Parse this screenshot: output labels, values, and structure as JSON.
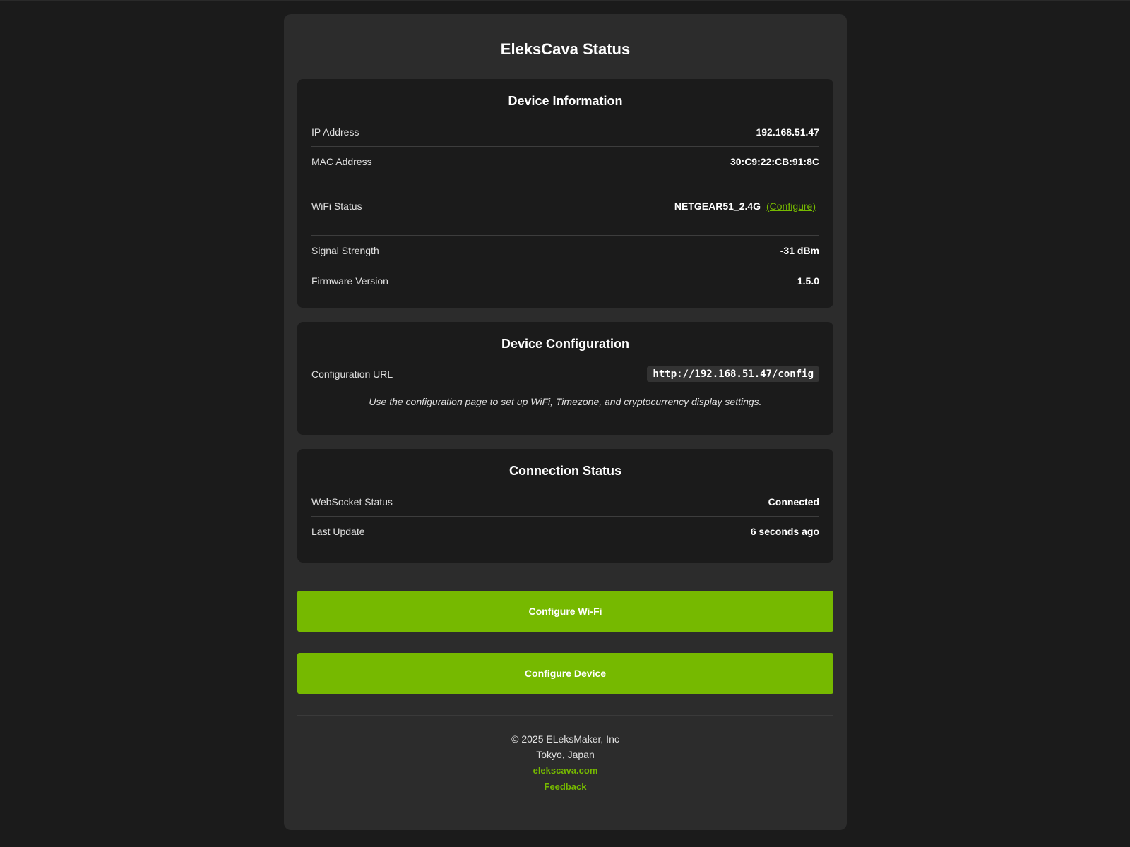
{
  "page": {
    "title": "EleksCava Status"
  },
  "device_info": {
    "title": "Device Information",
    "rows": [
      {
        "label": "IP Address",
        "value": "192.168.51.47"
      },
      {
        "label": "MAC Address",
        "value": "30:C9:22:CB:91:8C"
      },
      {
        "label": "WiFi Status",
        "value": "NETGEAR51_2.4G",
        "link": "(Configure)"
      },
      {
        "label": "Signal Strength",
        "value": "-31 dBm"
      },
      {
        "label": "Firmware Version",
        "value": "1.5.0"
      }
    ]
  },
  "device_config": {
    "title": "Device Configuration",
    "url_label": "Configuration URL",
    "url_value": "http://192.168.51.47/config",
    "note": "Use the configuration page to set up WiFi, Timezone, and cryptocurrency display settings."
  },
  "connection": {
    "title": "Connection Status",
    "rows": [
      {
        "label": "WebSocket Status",
        "value": "Connected"
      },
      {
        "label": "Last Update",
        "value": "6 seconds ago"
      }
    ]
  },
  "buttons": {
    "configure_wifi": "Configure Wi-Fi",
    "configure_device": "Configure Device"
  },
  "footer": {
    "copyright": "© 2025 ELeksMaker, Inc",
    "location": "Tokyo, Japan",
    "website": "elekscava.com",
    "feedback": "Feedback"
  },
  "colors": {
    "accent": "#76b900",
    "background": "#1b1b1b",
    "panel": "#2c2c2c"
  }
}
